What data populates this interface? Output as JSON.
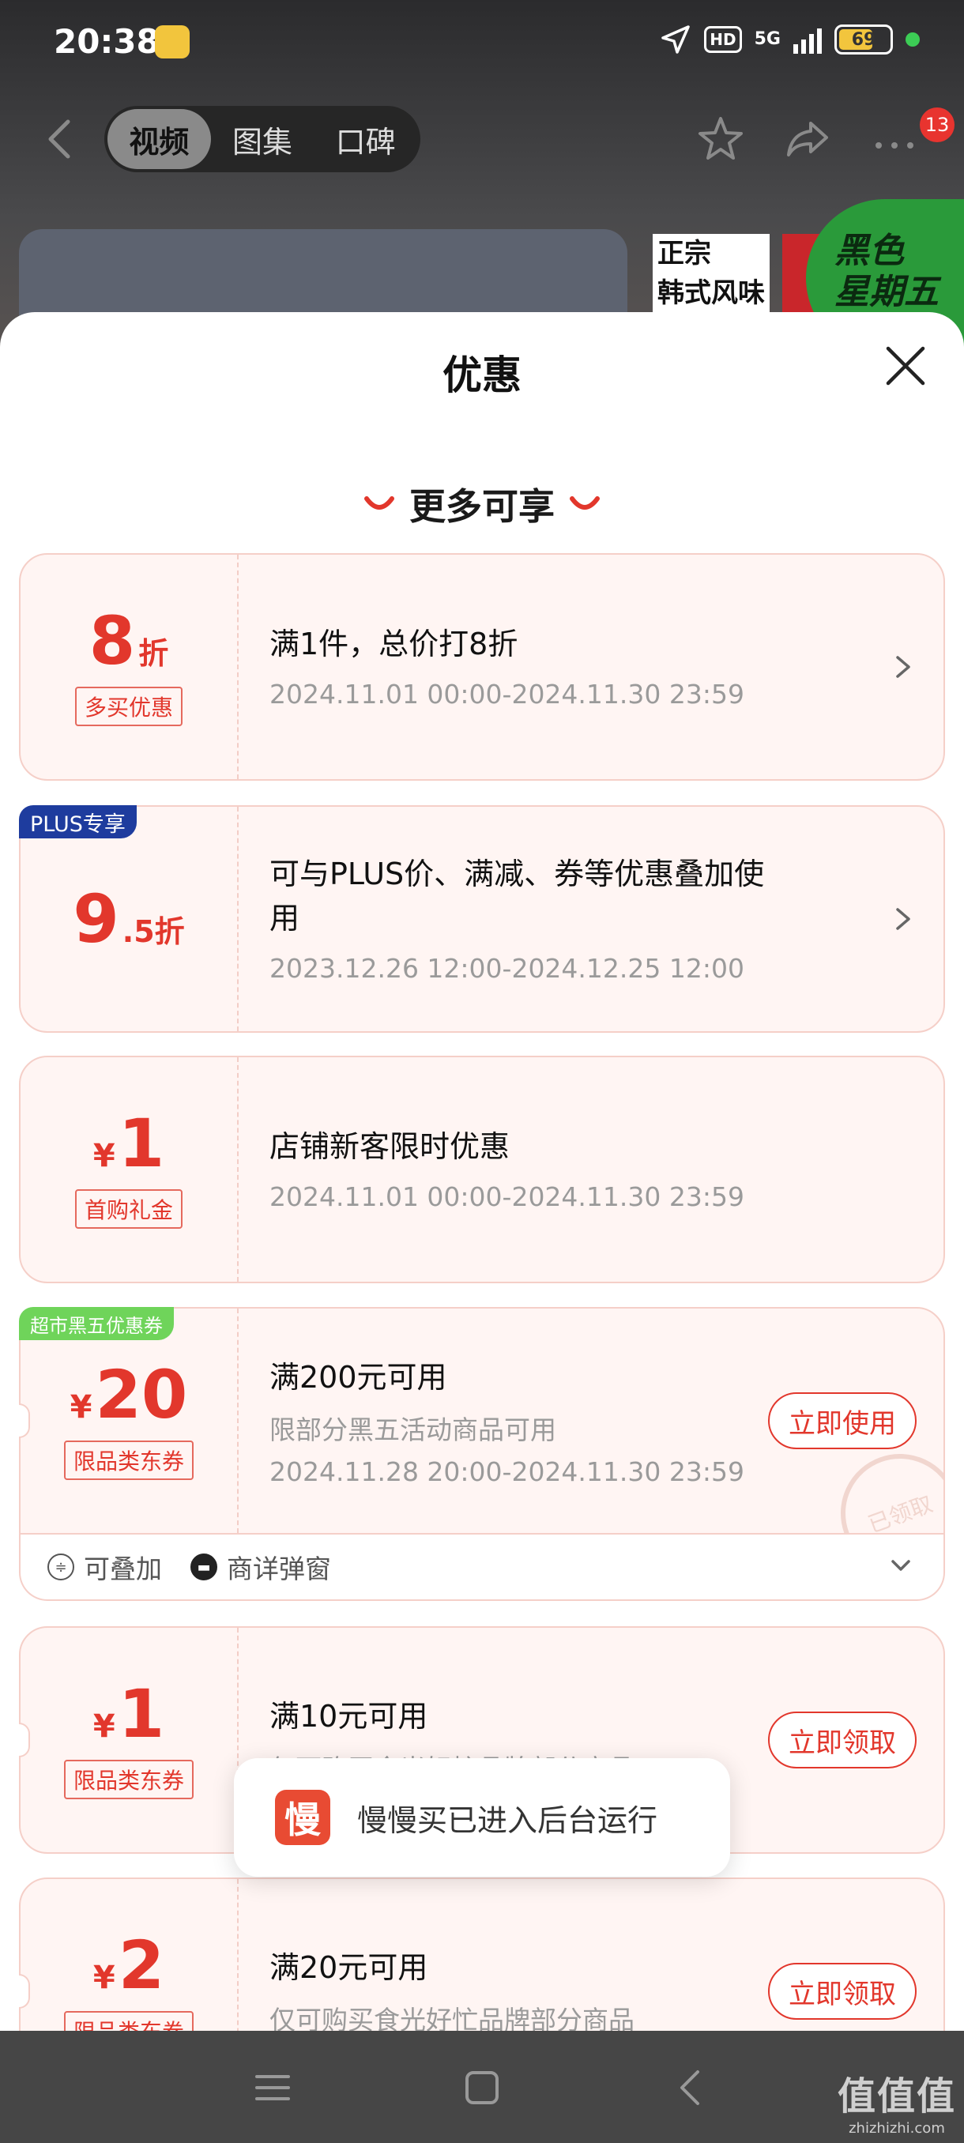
{
  "status_bar": {
    "time": "20:38",
    "network": "5G",
    "hd": "HD",
    "battery": "69"
  },
  "top_nav": {
    "tabs": [
      {
        "label": "视频",
        "active": true
      },
      {
        "label": "图集",
        "active": false
      },
      {
        "label": "口碑",
        "active": false
      }
    ],
    "more_badge": "13"
  },
  "background_ad": {
    "line1": "正宗",
    "line2": "韩式风味",
    "promo_line1": "黑色",
    "promo_line2": "星期五"
  },
  "sheet": {
    "title": "优惠",
    "section_title": "更多可享",
    "accent_color": "#e2372c"
  },
  "coupons": [
    {
      "amount_big": "8",
      "amount_suffix": "折",
      "tag": "多买优惠",
      "title": "满1件，总价打8折",
      "period": "2024.11.01 00:00-2024.11.30 23:59"
    },
    {
      "corner_label": "PLUS专享",
      "amount_big": "9",
      "amount_suffix": ".5折",
      "title": "可与PLUS价、满减、券等优惠叠加使用",
      "period": "2023.12.26 12:00-2024.12.25 12:00"
    },
    {
      "currency": "¥",
      "amount_big": "1",
      "tag": "首购礼金",
      "title": "店铺新客限时优惠",
      "period": "2024.11.01 00:00-2024.11.30 23:59"
    },
    {
      "corner_label": "超市黑五优惠券",
      "currency": "¥",
      "amount_big": "20",
      "tag": "限品类东券",
      "title": "满200元可用",
      "desc": "限部分黑五活动商品可用",
      "period": "2024.11.28 20:00-2024.11.30 23:59",
      "button": "立即使用",
      "stamp": "已领取",
      "footer": {
        "stackable": "可叠加",
        "popup": "商详弹窗"
      }
    },
    {
      "currency": "¥",
      "amount_big": "1",
      "tag": "限品类东券",
      "title": "满10元可用",
      "desc": "仅可购买食光好忙品牌部分商品",
      "button": "立即领取"
    },
    {
      "currency": "¥",
      "amount_big": "2",
      "tag": "限品类东券",
      "title": "满20元可用",
      "desc": "仅可购买食光好忙品牌部分商品",
      "button": "立即领取"
    }
  ],
  "toast": {
    "icon_char": "慢",
    "text": "慢慢买已进入后台运行"
  },
  "watermark": {
    "main": "值值值",
    "sub": "zhizhizhi.com"
  }
}
